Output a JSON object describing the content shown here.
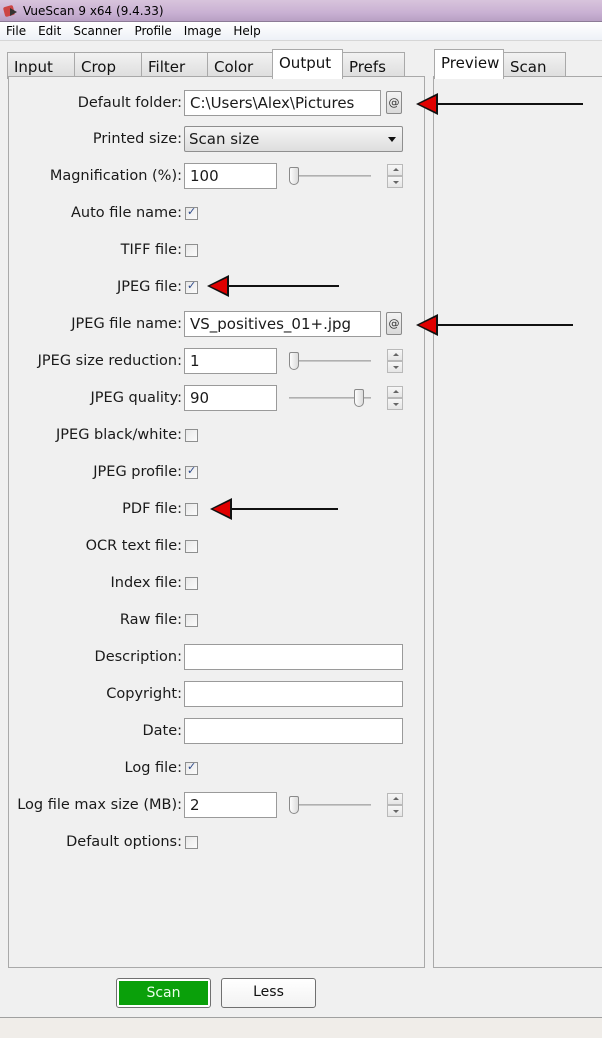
{
  "window": {
    "title": "VueScan 9 x64 (9.4.33)"
  },
  "menu": [
    "File",
    "Edit",
    "Scanner",
    "Profile",
    "Image",
    "Help"
  ],
  "left_tabs": [
    {
      "label": "Input",
      "active": false
    },
    {
      "label": "Crop",
      "active": false
    },
    {
      "label": "Filter",
      "active": false
    },
    {
      "label": "Color",
      "active": false
    },
    {
      "label": "Output",
      "active": true
    },
    {
      "label": "Prefs",
      "active": false
    }
  ],
  "right_tabs": [
    {
      "label": "Preview",
      "active": true
    },
    {
      "label": "Scan",
      "active": false
    }
  ],
  "output": {
    "default_folder": {
      "label": "Default folder:",
      "value": "C:\\Users\\Alex\\Pictures",
      "at_button": "@"
    },
    "printed_size": {
      "label": "Printed size:",
      "value": "Scan size"
    },
    "magnification": {
      "label": "Magnification (%):",
      "value": "100",
      "slider_fraction": 0.0
    },
    "auto_file_name": {
      "label": "Auto file name:",
      "checked": true
    },
    "tiff_file": {
      "label": "TIFF file:",
      "checked": false
    },
    "jpeg_file": {
      "label": "JPEG file:",
      "checked": true
    },
    "jpeg_file_name": {
      "label": "JPEG file name:",
      "value": "VS_positives_01+.jpg",
      "at_button": "@"
    },
    "jpeg_size_reduction": {
      "label": "JPEG size reduction:",
      "value": "1",
      "slider_fraction": 0.0
    },
    "jpeg_quality": {
      "label": "JPEG quality:",
      "value": "90",
      "slider_fraction": 0.9
    },
    "jpeg_black_white": {
      "label": "JPEG black/white:",
      "checked": false
    },
    "jpeg_profile": {
      "label": "JPEG profile:",
      "checked": true
    },
    "pdf_file": {
      "label": "PDF file:",
      "checked": false
    },
    "ocr_text_file": {
      "label": "OCR text file:",
      "checked": false
    },
    "index_file": {
      "label": "Index file:",
      "checked": false
    },
    "raw_file": {
      "label": "Raw file:",
      "checked": false
    },
    "description": {
      "label": "Description:",
      "value": ""
    },
    "copyright": {
      "label": "Copyright:",
      "value": ""
    },
    "date": {
      "label": "Date:",
      "value": ""
    },
    "log_file": {
      "label": "Log file:",
      "checked": true
    },
    "log_file_max_size": {
      "label": "Log file max size (MB):",
      "value": "2",
      "slider_fraction": 0.0
    },
    "default_options": {
      "label": "Default options:",
      "checked": false
    }
  },
  "buttons": {
    "scan": "Scan",
    "less": "Less"
  },
  "colors": {
    "scan_button": "#0aa00a",
    "annotation_arrow": "#e00000"
  }
}
